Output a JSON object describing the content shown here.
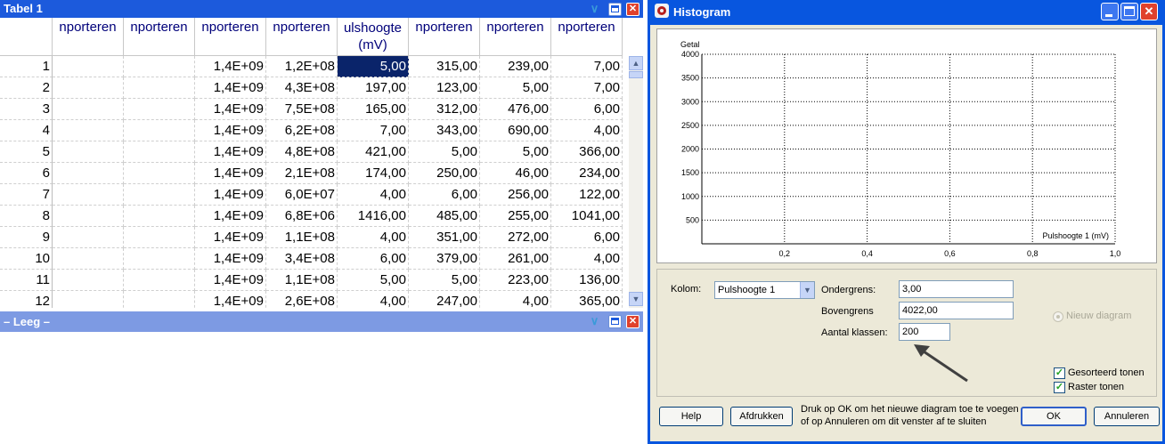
{
  "tabel": {
    "title": "Tabel 1",
    "columns": [
      "",
      "nporteren",
      "nporteren",
      "nporteren",
      "nporteren",
      "ulshoogte\n(mV)",
      "nporteren",
      "nporteren",
      "nporteren"
    ],
    "rows": [
      [
        "1",
        "",
        "",
        "1,4E+09",
        "1,2E+08",
        "5,00",
        "315,00",
        "239,00",
        "7,00"
      ],
      [
        "2",
        "",
        "",
        "1,4E+09",
        "4,3E+08",
        "197,00",
        "123,00",
        "5,00",
        "7,00"
      ],
      [
        "3",
        "",
        "",
        "1,4E+09",
        "7,5E+08",
        "165,00",
        "312,00",
        "476,00",
        "6,00"
      ],
      [
        "4",
        "",
        "",
        "1,4E+09",
        "6,2E+08",
        "7,00",
        "343,00",
        "690,00",
        "4,00"
      ],
      [
        "5",
        "",
        "",
        "1,4E+09",
        "4,8E+08",
        "421,00",
        "5,00",
        "5,00",
        "366,00"
      ],
      [
        "6",
        "",
        "",
        "1,4E+09",
        "2,1E+08",
        "174,00",
        "250,00",
        "46,00",
        "234,00"
      ],
      [
        "7",
        "",
        "",
        "1,4E+09",
        "6,0E+07",
        "4,00",
        "6,00",
        "256,00",
        "122,00"
      ],
      [
        "8",
        "",
        "",
        "1,4E+09",
        "6,8E+06",
        "1416,00",
        "485,00",
        "255,00",
        "1041,00"
      ],
      [
        "9",
        "",
        "",
        "1,4E+09",
        "1,1E+08",
        "4,00",
        "351,00",
        "272,00",
        "6,00"
      ],
      [
        "10",
        "",
        "",
        "1,4E+09",
        "3,4E+08",
        "6,00",
        "379,00",
        "261,00",
        "4,00"
      ],
      [
        "11",
        "",
        "",
        "1,4E+09",
        "1,1E+08",
        "5,00",
        "5,00",
        "223,00",
        "136,00"
      ],
      [
        "12",
        "",
        "",
        "1,4E+09",
        "2,6E+08",
        "4,00",
        "247,00",
        "4,00",
        "365,00"
      ]
    ],
    "selected_cell": {
      "row": 0,
      "col": 5
    }
  },
  "leeg": {
    "title": "– Leeg –"
  },
  "histogram": {
    "title": "Histogram",
    "chart": {
      "ylabel": "Getal",
      "xlabel": "Pulshoogte 1 (mV)",
      "y_ticks": [
        "4000",
        "3500",
        "3000",
        "2500",
        "2000",
        "1500",
        "1000",
        "500"
      ],
      "x_ticks": [
        "0,2",
        "0,4",
        "0,6",
        "0,8",
        "1,0"
      ]
    },
    "kolom_label": "Kolom:",
    "kolom_value": "Pulshoogte 1",
    "ondergrens_label": "Ondergrens:",
    "ondergrens_value": "3,00",
    "bovengrens_label": "Bovengrens",
    "bovengrens_value": "4022,00",
    "aantal_label": "Aantal klassen:",
    "aantal_value": "200",
    "nieuw_diagram": "Nieuw diagram",
    "gesorteerd": "Gesorteerd tonen",
    "raster": "Raster tonen",
    "help": "Help",
    "afdrukken": "Afdrukken",
    "info_line1": "Druk op OK om het nieuwe diagram toe te voegen",
    "info_line2": "of op Annuleren om dit venster af te sluiten",
    "ok": "OK",
    "annuleren": "Annuleren"
  },
  "chart_data": {
    "type": "bar",
    "title": "",
    "xlabel": "Pulshoogte 1 (mV)",
    "ylabel": "Getal",
    "xlim": [
      0,
      1.0
    ],
    "ylim": [
      0,
      4000
    ],
    "x_ticks": [
      0.2,
      0.4,
      0.6,
      0.8,
      1.0
    ],
    "y_ticks": [
      500,
      1000,
      1500,
      2000,
      2500,
      3000,
      3500,
      4000
    ],
    "grid": true,
    "series": []
  },
  "colors": {
    "titlebar_active": "#1c5adc",
    "titlebar_inactive": "#7d9ae3",
    "selection": "#0a246a",
    "header_text": "#00007a",
    "dialog_face": "#ece9d8"
  }
}
